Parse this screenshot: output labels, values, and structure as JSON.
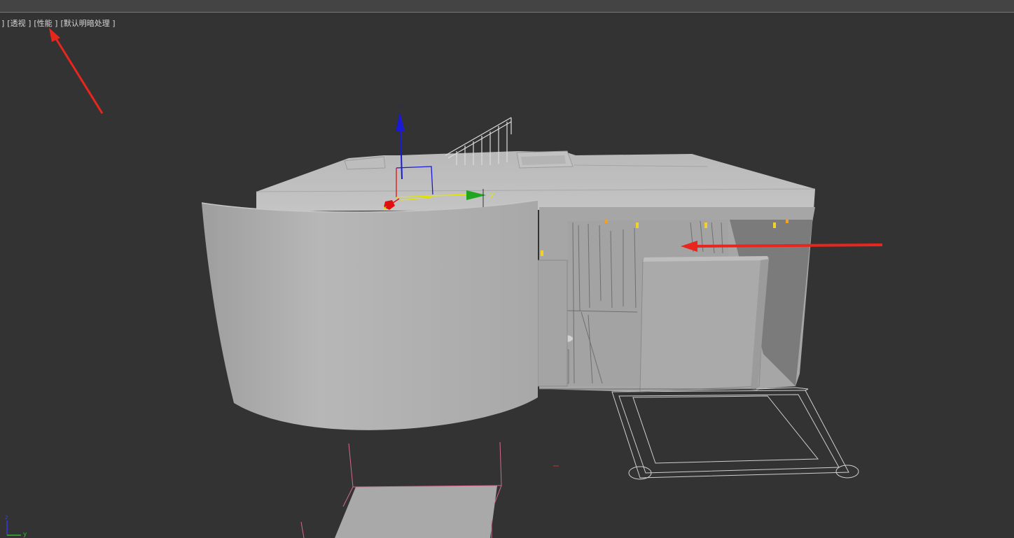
{
  "viewport": {
    "labels": [
      {
        "id": "menu",
        "text": "]"
      },
      {
        "id": "view",
        "text": "[透视 ]"
      },
      {
        "id": "quality",
        "text": "[性能 ]"
      },
      {
        "id": "shading",
        "text": "[默认明暗处理 ]"
      }
    ]
  },
  "gizmo": {
    "z": "z",
    "y": "y",
    "x": "x"
  },
  "corner_axis": {
    "z": "z",
    "y": "y"
  },
  "colors": {
    "background": "#333333",
    "model": "#b3b3b3",
    "annotation_arrow": "#e8261e",
    "axis_x": "#e01010",
    "axis_y": "#1fa51f",
    "axis_z": "#1a1ad6",
    "plane_xy": "#e6e600"
  }
}
